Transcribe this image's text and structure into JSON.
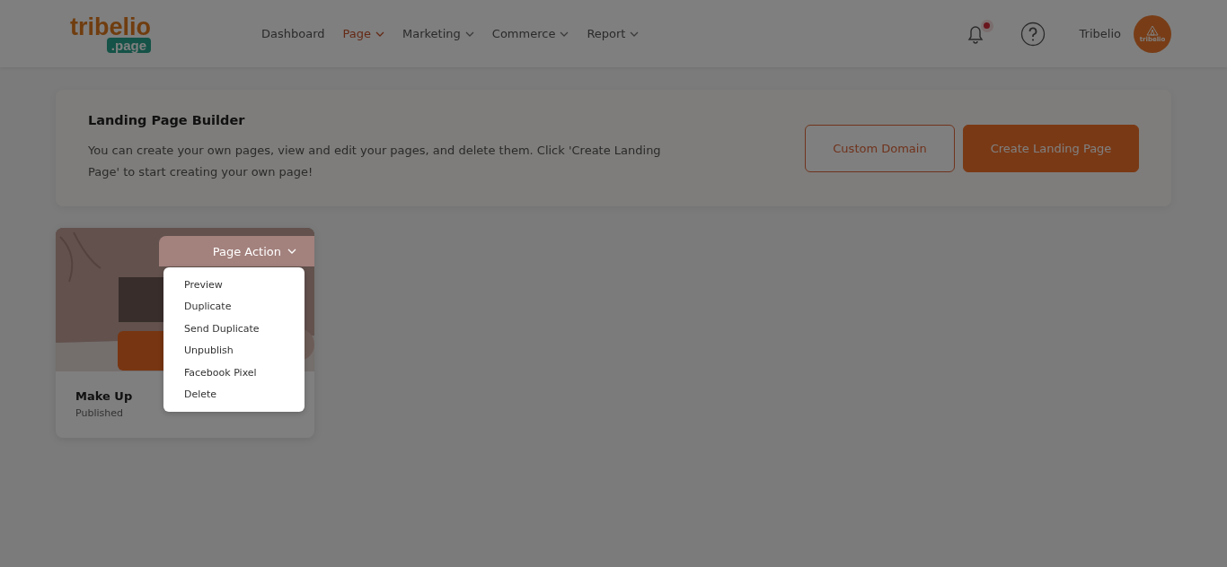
{
  "logo": {
    "name": "tribelio",
    "suffix": ".page"
  },
  "nav": [
    {
      "label": "Dashboard",
      "selected": false,
      "dropdown": false
    },
    {
      "label": "Page",
      "selected": true,
      "dropdown": true
    },
    {
      "label": "Marketing",
      "selected": false,
      "dropdown": true
    },
    {
      "label": "Commerce",
      "selected": false,
      "dropdown": true
    },
    {
      "label": "Report",
      "selected": false,
      "dropdown": true
    }
  ],
  "notifications": {
    "unread": true
  },
  "user": {
    "name": "Tribelio",
    "avatar_text": "tribelio"
  },
  "banner": {
    "title": "Landing Page Builder",
    "description": "You can create your own pages, view and edit your pages, and delete them. Click 'Create Landing Page' to start creating your own page!",
    "buttons": [
      {
        "label": "Custom Domain",
        "kind": "outline"
      },
      {
        "label": "Create Landing Page",
        "kind": "primary"
      }
    ]
  },
  "pages": [
    {
      "title": "Make Up",
      "status": "Published",
      "action": "Page Action",
      "menu_open": true,
      "menu": [
        "Preview",
        "Duplicate",
        "Send Duplicate",
        "Unpublish",
        "Facebook Pixel",
        "Delete"
      ]
    }
  ],
  "overlay": true
}
